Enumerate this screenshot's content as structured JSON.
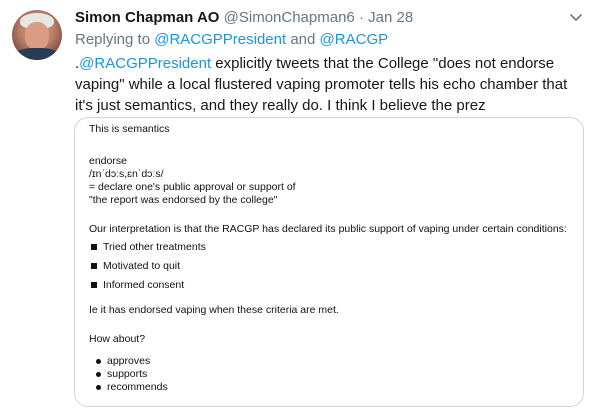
{
  "tweet": {
    "author_name": "Simon Chapman AO",
    "handle": "@SimonChapman6",
    "separator": "·",
    "date": "Jan 28",
    "reply_prefix": "Replying to ",
    "reply_to_1": "@RACGPPresident",
    "reply_and": " and ",
    "reply_to_2": "@RACGP",
    "body_prefix": ".",
    "body_mention": "@RACGPPresident",
    "body_text": " explicitly tweets that the College \"does not endorse vaping\" while a local flustered vaping promoter tells his echo chamber that it's just semantics, and they really do. I think I believe the prez",
    "menu_icon": "chevron-down-icon",
    "colors": {
      "link": "#1b95e0",
      "muted": "#657786",
      "text": "#14171a",
      "border": "#ccd6dd"
    }
  },
  "image_doc": {
    "heading": "This is semantics",
    "word": "endorse",
    "pronunciation": "/ɪnˈdɔːs,ɛnˈdɔːs/",
    "definition": "= declare one's public approval or support of",
    "example": "\"the report was endorsed by the college\"",
    "interpretation": "Our interpretation is that the RACGP  has declared its public support of vaping under certain conditions:",
    "conditions": [
      "Tried other treatments",
      "Motivated to quit",
      "Informed consent"
    ],
    "conclusion": "Ie it has endorsed vaping when these criteria are met.",
    "question": "How about?",
    "alternatives": [
      "approves",
      "supports",
      "recommends"
    ]
  }
}
